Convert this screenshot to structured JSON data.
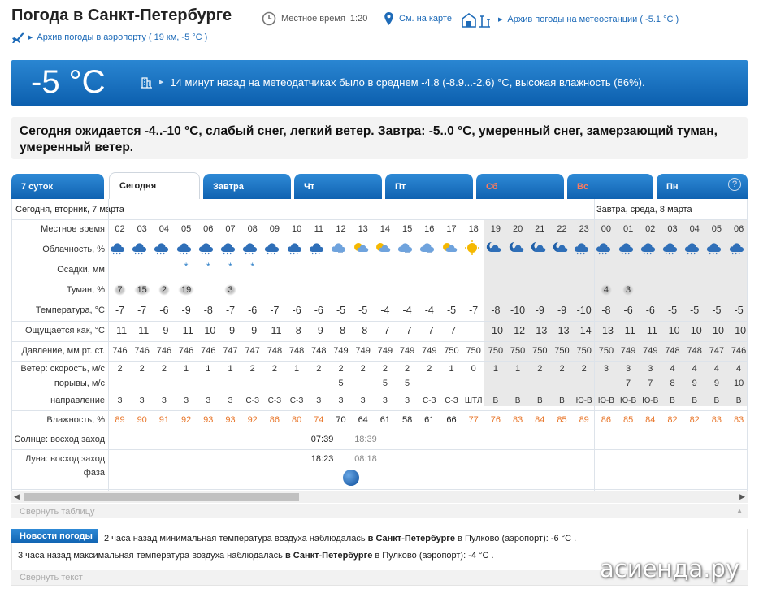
{
  "header": {
    "title": "Погода в Санкт-Петербурге",
    "local_time_label": "Местное время",
    "local_time": "1:20",
    "map_link": "См. на карте",
    "archive_station": "Архив погоды на метеостанции ( -5.1 °C )",
    "archive_airport": "Архив погоды в аэропорту ( 19 км, -5 °C )"
  },
  "now": {
    "temp": "-5 °C",
    "text": "14 минут назад на метеодатчиках было в среднем -4.8 (-8.9...-2.6) °C, высокая влажность (86%)."
  },
  "forecast_text": "Сегодня ожидается -4..-10 °C, слабый снег, легкий ветер. Завтра: -5..0 °C, умеренный снег, замерзающий туман, умеренный ветер.",
  "tabs": [
    {
      "label": "7 суток",
      "active": false,
      "red": false
    },
    {
      "label": "Сегодня",
      "active": true,
      "red": false
    },
    {
      "label": "Завтра",
      "active": false,
      "red": false
    },
    {
      "label": "Чт",
      "active": false,
      "red": false
    },
    {
      "label": "Пт",
      "active": false,
      "red": false
    },
    {
      "label": "Сб",
      "active": false,
      "red": true
    },
    {
      "label": "Вс",
      "active": false,
      "red": true
    },
    {
      "label": "Пн",
      "active": false,
      "red": false
    }
  ],
  "help": "?",
  "table": {
    "day1": "Сегодня, вторник, 7 марта",
    "day2": "Завтра, среда, 8 марта",
    "labels": {
      "time": "Местное время",
      "cloud": "Облачность, %",
      "precip": "Осадки, мм",
      "fog": "Туман, %",
      "temp": "Температура, °С",
      "feels": "Ощущается как, °С",
      "pressure": "Давление, мм рт. ст.",
      "wind_speed": "Ветер: скорость, м/с",
      "gusts": "порывы, м/с",
      "direction": "направление",
      "humidity": "Влажность, %",
      "sun": "Солнце: восход заход",
      "moon": "Луна: восход заход",
      "phase": "фаза"
    },
    "hours": [
      "02",
      "03",
      "04",
      "05",
      "06",
      "07",
      "08",
      "09",
      "10",
      "11",
      "12",
      "13",
      "14",
      "15",
      "16",
      "17",
      "18",
      "19",
      "20",
      "21",
      "22",
      "23",
      "00",
      "01",
      "02",
      "03",
      "04",
      "05",
      "06"
    ],
    "cloud_icons": [
      "snow-cloud-icon",
      "snow-cloud-icon",
      "snow-cloud-icon",
      "snow-cloud-icon",
      "snow-cloud-icon",
      "snow-cloud-icon",
      "snow-cloud-icon",
      "snow-cloud-icon",
      "snow-cloud-icon",
      "snow-cloud-icon",
      "cloud-icon",
      "sun-cloud-icon",
      "sun-cloud-icon",
      "cloud-icon",
      "cloud-icon",
      "sun-cloud-icon",
      "sun-icon",
      "moon-cloud-icon",
      "moon-cloud-icon",
      "moon-cloud-icon",
      "moon-cloud-icon",
      "snow-cloud-icon",
      "snow-cloud-icon",
      "snow-cloud-icon",
      "snow-cloud-icon",
      "snow-cloud-icon",
      "snow-cloud-icon",
      "snow-cloud-icon",
      "snow-cloud-icon"
    ],
    "precip": [
      "",
      "",
      "",
      "*",
      "*",
      "*",
      "*",
      "",
      "",
      "",
      "",
      "",
      "",
      "",
      "",
      "",
      "",
      "",
      "",
      "",
      "",
      "",
      "",
      "",
      "",
      "",
      "",
      "",
      ""
    ],
    "fog": [
      "7",
      "15",
      "2",
      "19",
      "",
      "3",
      "",
      "",
      "",
      "",
      "",
      "",
      "",
      "",
      "",
      "",
      "",
      "",
      "",
      "",
      "",
      "",
      "4",
      "3",
      "",
      "",
      "",
      "",
      ""
    ],
    "temp": [
      "-7",
      "-7",
      "-6",
      "-9",
      "-8",
      "-7",
      "-6",
      "-7",
      "-6",
      "-6",
      "-5",
      "-5",
      "-4",
      "-4",
      "-4",
      "-5",
      "-7",
      "-8",
      "-10",
      "-9",
      "-9",
      "-10",
      "-8",
      "-6",
      "-6",
      "-5",
      "-5",
      "-5",
      "-5"
    ],
    "feels": [
      "-11",
      "-11",
      "-9",
      "-11",
      "-10",
      "-9",
      "-9",
      "-11",
      "-8",
      "-9",
      "-8",
      "-8",
      "-7",
      "-7",
      "-7",
      "-7",
      "",
      "-10",
      "-12",
      "-13",
      "-13",
      "-14",
      "-13",
      "-11",
      "-11",
      "-10",
      "-10",
      "-10",
      "-10"
    ],
    "pressure": [
      "746",
      "746",
      "746",
      "746",
      "746",
      "747",
      "747",
      "748",
      "748",
      "748",
      "749",
      "749",
      "749",
      "749",
      "749",
      "750",
      "750",
      "750",
      "750",
      "750",
      "750",
      "750",
      "750",
      "749",
      "749",
      "748",
      "748",
      "747",
      "746"
    ],
    "wind_speed": [
      "2",
      "2",
      "2",
      "1",
      "1",
      "1",
      "2",
      "2",
      "1",
      "2",
      "2",
      "2",
      "2",
      "2",
      "2",
      "1",
      "0",
      "1",
      "1",
      "2",
      "2",
      "2",
      "3",
      "3",
      "3",
      "4",
      "4",
      "4",
      "4"
    ],
    "gusts": [
      "",
      "",
      "",
      "",
      "",
      "",
      "",
      "",
      "",
      "",
      "5",
      "",
      "5",
      "5",
      "",
      "",
      "",
      "",
      "",
      "",
      "",
      "",
      "",
      "7",
      "7",
      "8",
      "9",
      "9",
      "10"
    ],
    "direction": [
      "З",
      "З",
      "З",
      "З",
      "З",
      "З",
      "С-З",
      "С-З",
      "С-З",
      "З",
      "З",
      "З",
      "З",
      "З",
      "С-З",
      "С-З",
      "ШТЛ",
      "В",
      "В",
      "В",
      "В",
      "Ю-В",
      "Ю-В",
      "Ю-В",
      "Ю-В",
      "В",
      "В",
      "В",
      "В"
    ],
    "humidity": [
      "89",
      "90",
      "91",
      "92",
      "93",
      "93",
      "92",
      "86",
      "80",
      "74",
      "70",
      "64",
      "61",
      "58",
      "61",
      "66",
      "77",
      "76",
      "83",
      "84",
      "85",
      "89",
      "86",
      "85",
      "84",
      "82",
      "82",
      "83",
      "83"
    ],
    "humidity_colors": [
      "orange",
      "orange",
      "orange",
      "orange",
      "orange",
      "orange",
      "orange",
      "orange",
      "orange",
      "orange",
      "black",
      "black",
      "black",
      "black",
      "black",
      "black",
      "orange",
      "orange",
      "orange",
      "orange",
      "orange",
      "orange",
      "orange",
      "orange",
      "orange",
      "orange",
      "orange",
      "orange",
      "orange"
    ],
    "sunrise": "07:39",
    "sunset": "18:39",
    "moonrise": "18:23",
    "moonset": "08:18"
  },
  "collapse_table": "Свернуть таблицу",
  "news": {
    "label": "Новости погоды",
    "item1_pre": "2 часа назад минимальная температура воздуха наблюдалась ",
    "item1_city": "в Санкт-Петербурге",
    "item1_post": " в Пулково (аэропорт): -6 °C .",
    "item2_pre": "3 часа назад максимальная температура воздуха наблюдалась ",
    "item2_city": "в Санкт-Петербурге",
    "item2_post": " в Пулково (аэропорт): -4 °C .",
    "collapse": "Свернуть текст"
  },
  "watermark": "асиенда.ру",
  "colors": {
    "accent": "#1e6bb8",
    "bar_top": "#2a86d2",
    "bar_bottom": "#0c5fae",
    "humidity_high": "#e8762a"
  }
}
